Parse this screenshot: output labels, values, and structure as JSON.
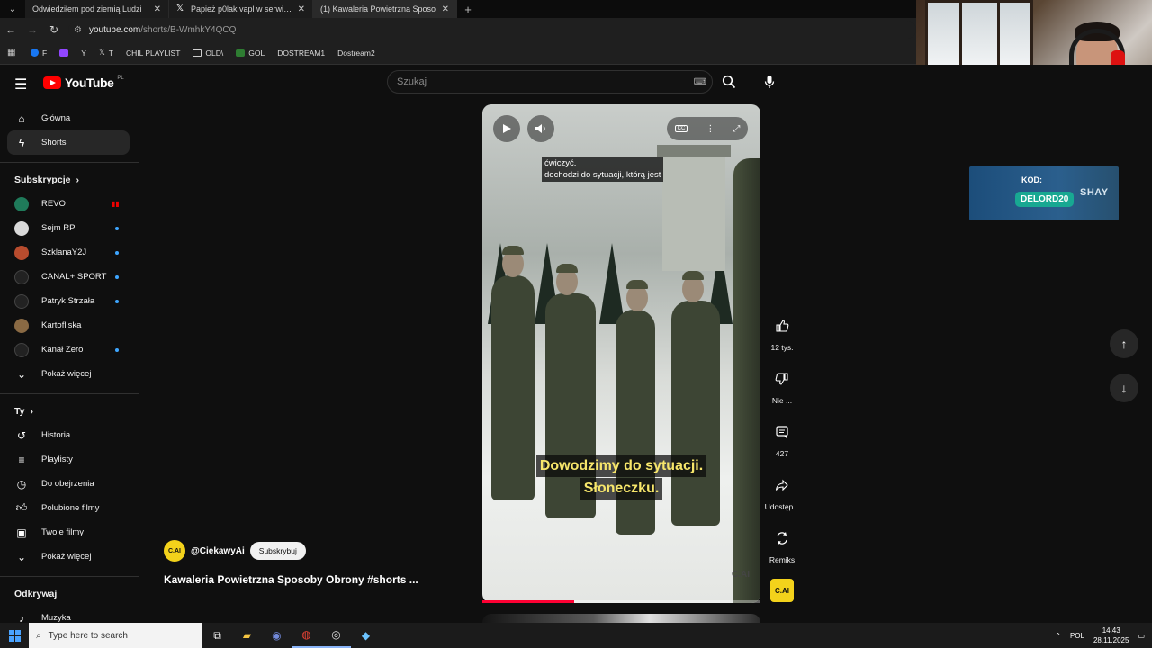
{
  "browser": {
    "tabs": [
      {
        "title": "Odwiedziłem pod ziemią Ludzi",
        "icon": "youtube",
        "active": false
      },
      {
        "title": "Papież p0lak vapl w serwisie X",
        "icon": "x",
        "active": false
      },
      {
        "title": "(1) Kawaleria Powietrzna Sposo",
        "icon": "youtube",
        "active": true
      }
    ],
    "new_tab": "+",
    "url_host": "youtube.com",
    "url_path": "/shorts/B-WmhkY4QCQ",
    "bookmarks": [
      {
        "label": "F",
        "icon": "facebook"
      },
      {
        "label": "Y",
        "icon": "youtube"
      },
      {
        "label": "",
        "icon": "twitch"
      },
      {
        "label": "T",
        "icon": "x"
      },
      {
        "label": "CHIL PLAYLIST",
        "icon": "youtube"
      },
      {
        "label": "OLD\\",
        "icon": "folder"
      },
      {
        "label": "GOL",
        "icon": "gol"
      },
      {
        "label": "DOSTREAM1",
        "icon": "youtube"
      },
      {
        "label": "Dostream2",
        "icon": "youtube"
      }
    ]
  },
  "youtube": {
    "logo_text": "YouTube",
    "country": "PL",
    "search_placeholder": "Szukaj",
    "sidebar": {
      "main": [
        {
          "label": "Główna",
          "icon": "home"
        },
        {
          "label": "Shorts",
          "icon": "shorts",
          "active": true
        }
      ],
      "subscriptions_title": "Subskrypcje",
      "subscriptions": [
        {
          "label": "REVO",
          "indicator": "live",
          "color": "#1f7a5a"
        },
        {
          "label": "Sejm RP",
          "indicator": "dot",
          "color": "#d9d9d9"
        },
        {
          "label": "SzklanaY2J",
          "indicator": "dot",
          "color": "#b84c2e"
        },
        {
          "label": "CANAL+ SPORT",
          "indicator": "dot",
          "color": "#222222"
        },
        {
          "label": "Patryk Strzała",
          "indicator": "dot",
          "color": "#222222"
        },
        {
          "label": "Kartofliska",
          "indicator": "none",
          "color": "#8a6a44"
        },
        {
          "label": "Kanał Zero",
          "indicator": "dot",
          "color": "#222222"
        }
      ],
      "show_more": "Pokaż więcej",
      "you_title": "Ty",
      "you_items": [
        {
          "label": "Historia",
          "icon": "history"
        },
        {
          "label": "Playlisty",
          "icon": "playlist"
        },
        {
          "label": "Do obejrzenia",
          "icon": "clock"
        },
        {
          "label": "Polubione filmy",
          "icon": "like"
        },
        {
          "label": "Twoje filmy",
          "icon": "video"
        },
        {
          "label": "Pokaż więcej",
          "icon": "chevron-down"
        }
      ],
      "explore_title": "Odkrywaj",
      "explore_items": [
        {
          "label": "Muzyka",
          "icon": "music"
        }
      ]
    },
    "short": {
      "caption_top": [
        "ćwiczyć.",
        "dochodzi do sytuacji, którą jest"
      ],
      "caption_main": [
        "Dowodzimy do sytuacji.",
        "Słoneczku."
      ],
      "watermark": "C.AI",
      "progress": 0.33,
      "channel_handle": "@CiekawyAi",
      "channel_avatar": "C.AI",
      "subscribe_label": "Subskrybuj",
      "title": "Kawaleria Powietrzna Sposoby Obrony #shorts ..."
    },
    "actions": {
      "like_count": "12 tys.",
      "dislike_label": "Nie ...",
      "comments_count": "427",
      "share_label": "Udostęp...",
      "remix_label": "Remiks"
    }
  },
  "promo": {
    "kod_label": "KOD:",
    "code": "DELORD20",
    "brand": "SHAY"
  },
  "taskbar": {
    "search_placeholder": "Type here to search",
    "language": "POL",
    "time": "14:43",
    "date": "28.11.2025"
  }
}
